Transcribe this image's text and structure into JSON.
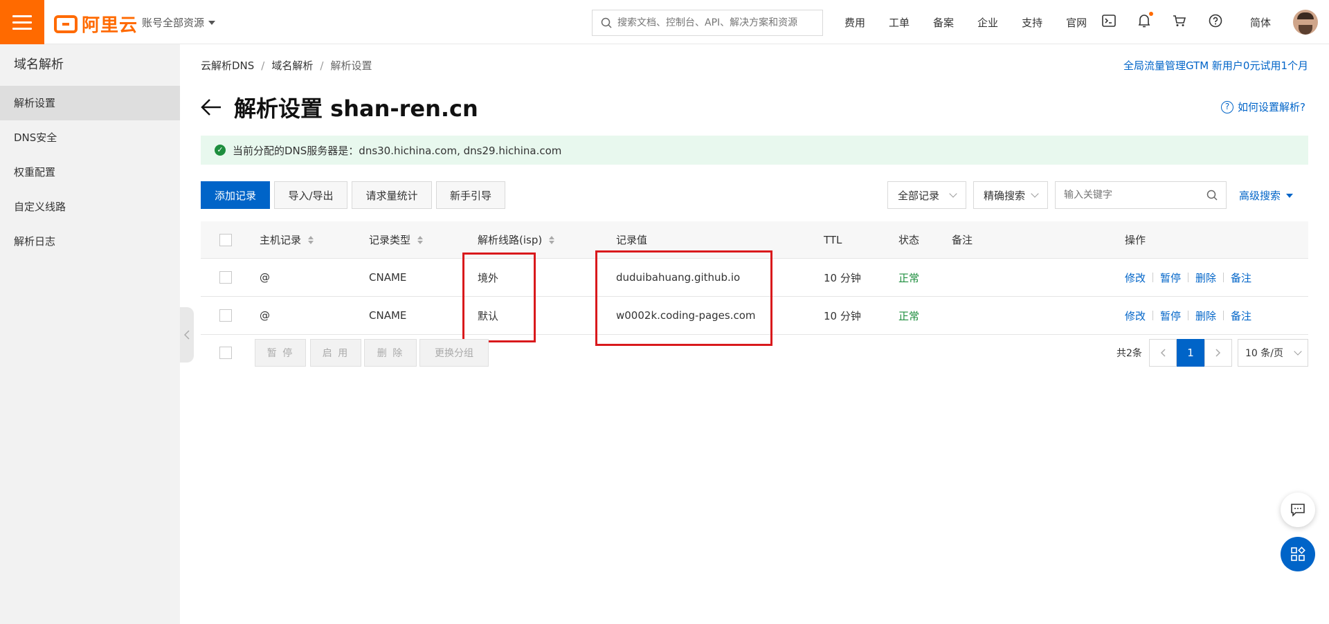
{
  "header": {
    "logo_text": "阿里云",
    "account_label": "账号全部资源",
    "search_placeholder": "搜索文档、控制台、API、解决方案和资源",
    "nav": [
      "费用",
      "工单",
      "备案",
      "企业",
      "支持",
      "官网"
    ],
    "icons": [
      "terminal-icon",
      "bell-icon",
      "cart-icon",
      "help-icon"
    ],
    "language": "简体"
  },
  "sidebar": {
    "title": "域名解析",
    "items": [
      {
        "label": "解析设置",
        "active": true
      },
      {
        "label": "DNS安全"
      },
      {
        "label": "权重配置"
      },
      {
        "label": "自定义线路"
      },
      {
        "label": "解析日志"
      }
    ]
  },
  "breadcrumb": [
    "云解析DNS",
    "域名解析",
    "解析设置"
  ],
  "promo_link": "全局流量管理GTM 新用户0元试用1个月",
  "page_title": "解析设置 shan-ren.cn",
  "help_link": "如何设置解析?",
  "notice": "当前分配的DNS服务器是：dns30.hichina.com, dns29.hichina.com",
  "toolbar": {
    "add": "添加记录",
    "import_export": "导入/导出",
    "stats": "请求量统计",
    "guide": "新手引导",
    "filter": "全部记录",
    "match": "精确搜索",
    "keyword_placeholder": "输入关键字",
    "advanced": "高级搜索"
  },
  "table": {
    "headers": [
      "主机记录",
      "记录类型",
      "解析线路(isp)",
      "记录值",
      "TTL",
      "状态",
      "备注",
      "操作"
    ],
    "rows": [
      {
        "host": "@",
        "type": "CNAME",
        "line": "境外",
        "value": "duduibahuang.github.io",
        "ttl": "10 分钟",
        "status": "正常",
        "remark": ""
      },
      {
        "host": "@",
        "type": "CNAME",
        "line": "默认",
        "value": "w0002k.coding-pages.com",
        "ttl": "10 分钟",
        "status": "正常",
        "remark": ""
      }
    ],
    "actions": [
      "修改",
      "暂停",
      "删除",
      "备注"
    ]
  },
  "footer": {
    "bulk": [
      "暂 停",
      "启 用",
      "删 除",
      "更换分组"
    ],
    "total": "共2条",
    "page": "1",
    "page_size": "10 条/页"
  },
  "colors": {
    "brand": "#ff6a00",
    "primary": "#0064c8",
    "success": "#1e8e3e",
    "highlight": "#d9191c"
  }
}
